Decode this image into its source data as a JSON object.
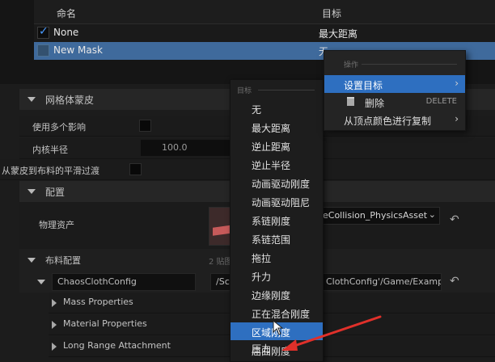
{
  "mask_table": {
    "col_name": "命名",
    "col_target": "目标",
    "rows": [
      {
        "name": "None",
        "target": "最大距离",
        "checked": true
      },
      {
        "name": "New Mask",
        "target": "无",
        "checked": false
      }
    ]
  },
  "details": {
    "section_skin": "网格体蒙皮",
    "use_multiple_influences": "使用多个影响",
    "kernel_radius": "内核半径",
    "kernel_radius_value": "100.0",
    "smooth_transition": "从蒙皮到布料的平滑过渡",
    "section_config": "配置",
    "physics_asset": "物理资产",
    "physics_asset_value": "eCollision_PhysicsAsset",
    "array_count_hint": "2 贴图",
    "section_cloth_config": "布料配置",
    "cloth_config_key": "ChaosClothConfig",
    "cloth_config_path_left": "/Sc",
    "cloth_config_path_right": "ClothConfig'/Game/Example",
    "sub_sections": [
      "Mass Properties",
      "Material Properties",
      "Long Range Attachment"
    ]
  },
  "target_dropdown": {
    "header": "目标",
    "items": [
      "无",
      "最大距离",
      "逆止距离",
      "逆止半径",
      "动画驱动刚度",
      "动画驱动阻尼",
      "系链刚度",
      "系链范围",
      "拖拉",
      "升力",
      "边缘刚度",
      "正在混合刚度",
      "区域刚度",
      "屈曲刚度",
      "压力"
    ],
    "selected": "区域刚度"
  },
  "context_menu": {
    "header": "操作",
    "set_target": "设置目标",
    "delete": "删除",
    "delete_shortcut": "DELETE",
    "copy_from_vertex_color": "从顶点颜色进行复制"
  },
  "colors": {
    "selection": "#2e6fc0",
    "row_selected": "#3f6a9c",
    "annotation_arrow": "#e0302a"
  }
}
